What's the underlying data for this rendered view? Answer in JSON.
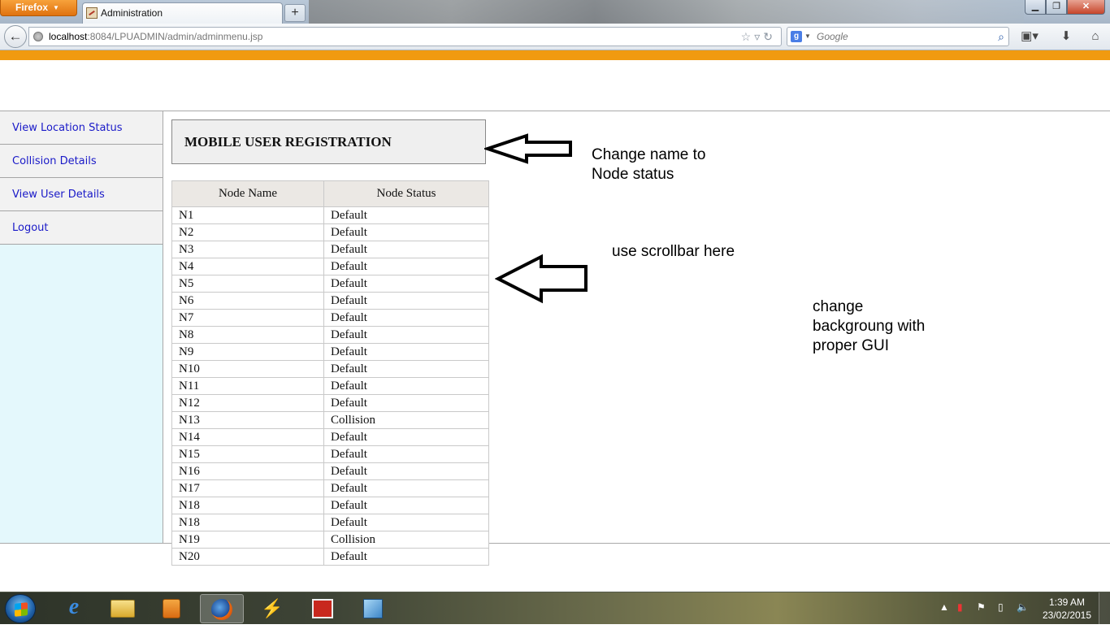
{
  "browser": {
    "menu_button": "Firefox",
    "tab_title": "Administration",
    "new_tab": "+",
    "url_host": "localhost",
    "url_rest": ":8084/LPUADMIN/admin/adminmenu.jsp",
    "search_placeholder": "Google",
    "search_engine_letter": "g",
    "window_controls": {
      "minimize": "▁",
      "maximize": "❐",
      "close": "✕"
    }
  },
  "sidebar": {
    "items": [
      {
        "label": "View Location Status"
      },
      {
        "label": "Collision Details"
      },
      {
        "label": "View User Details"
      },
      {
        "label": "Logout"
      }
    ]
  },
  "main": {
    "registration_title": "MOBILE USER REGISTRATION",
    "table": {
      "headers": [
        "Node Name",
        "Node Status"
      ],
      "rows": [
        [
          "N1",
          "Default"
        ],
        [
          "N2",
          "Default"
        ],
        [
          "N3",
          "Default"
        ],
        [
          "N4",
          "Default"
        ],
        [
          "N5",
          "Default"
        ],
        [
          "N6",
          "Default"
        ],
        [
          "N7",
          "Default"
        ],
        [
          "N8",
          "Default"
        ],
        [
          "N9",
          "Default"
        ],
        [
          "N10",
          "Default"
        ],
        [
          "N11",
          "Default"
        ],
        [
          "N12",
          "Default"
        ],
        [
          "N13",
          "Collision"
        ],
        [
          "N14",
          "Default"
        ],
        [
          "N15",
          "Default"
        ],
        [
          "N16",
          "Default"
        ],
        [
          "N17",
          "Default"
        ],
        [
          "N18",
          "Default"
        ],
        [
          "N18",
          "Default"
        ],
        [
          "N19",
          "Collision"
        ],
        [
          "N20",
          "Default"
        ]
      ]
    }
  },
  "annotations": {
    "note_1": "Change name to\nNode status",
    "note_2": "use scrollbar here",
    "note_3": "change\nbackgroung with\nproper GUI"
  },
  "taskbar": {
    "clock_time": "1:39 AM",
    "clock_date": "23/02/2015",
    "ie_label": "e"
  },
  "colors": {
    "accent_strip": "#f19a10",
    "sidebar_bg": "#e4f8fc",
    "link": "#1a1ac8"
  },
  "icons": [
    "back-arrow-icon",
    "globe-icon",
    "star-icon",
    "reload-icon",
    "search-icon",
    "bookmarks-icon",
    "download-icon",
    "home-icon"
  ]
}
